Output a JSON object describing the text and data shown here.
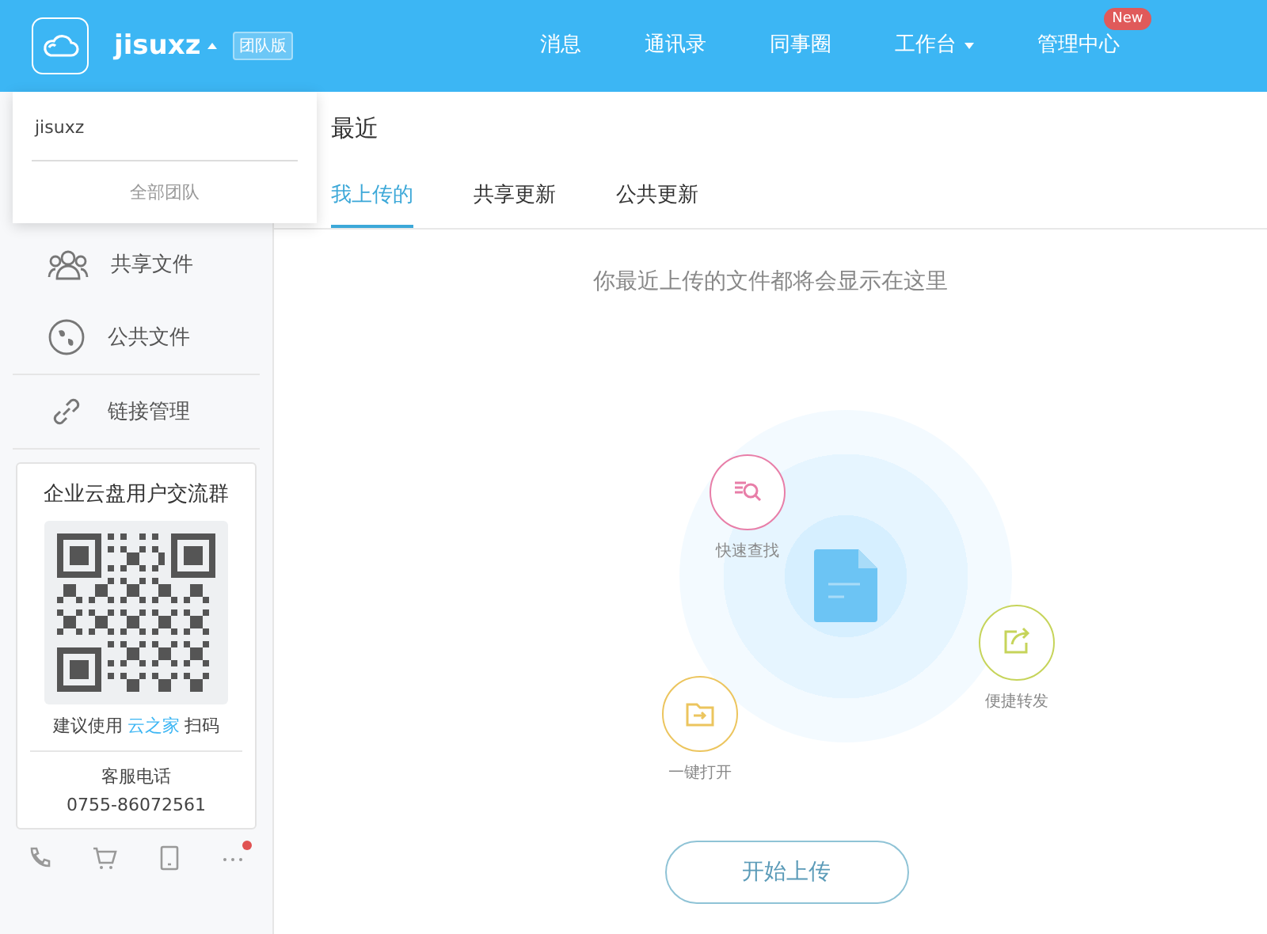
{
  "header": {
    "account": "jisuxz",
    "edition_badge": "团队版",
    "nav": [
      {
        "label": "消息",
        "has_menu": false
      },
      {
        "label": "通讯录",
        "has_menu": false
      },
      {
        "label": "同事圈",
        "has_menu": false
      },
      {
        "label": "工作台",
        "has_menu": true
      },
      {
        "label": "管理中心",
        "has_menu": false,
        "badge": "New"
      }
    ]
  },
  "account_menu": {
    "current": "jisuxz",
    "all_teams": "全部团队"
  },
  "sidebar": {
    "items": [
      {
        "kind": "shared",
        "label": "共享文件"
      },
      {
        "kind": "public",
        "label": "公共文件"
      },
      {
        "kind": "link",
        "label": "链接管理"
      }
    ],
    "group_card": {
      "title": "企业云盘用户交流群",
      "hint_before": "建议使用",
      "hint_link": "云之家",
      "hint_after": "扫码",
      "service_label": "客服电话",
      "service_phone": "0755-86072561"
    },
    "bottom_icons": [
      {
        "kind": "phone",
        "dot": false
      },
      {
        "kind": "cart",
        "dot": false
      },
      {
        "kind": "tablet",
        "dot": false
      },
      {
        "kind": "more",
        "dot": true
      }
    ]
  },
  "main": {
    "title": "最近",
    "tabs": [
      {
        "label": "我上传的",
        "selected": true
      },
      {
        "label": "共享更新",
        "selected": false
      },
      {
        "label": "公共更新",
        "selected": false
      }
    ],
    "empty_message": "你最近上传的文件都将会显示在这里",
    "features": [
      {
        "kind": "search",
        "label": "快速查找",
        "color": "#e87ea8"
      },
      {
        "kind": "forward",
        "label": "便捷转发",
        "color": "#c6d45a"
      },
      {
        "kind": "open",
        "label": "一键打开",
        "color": "#ecc55e"
      }
    ],
    "upload_button": "开始上传"
  }
}
